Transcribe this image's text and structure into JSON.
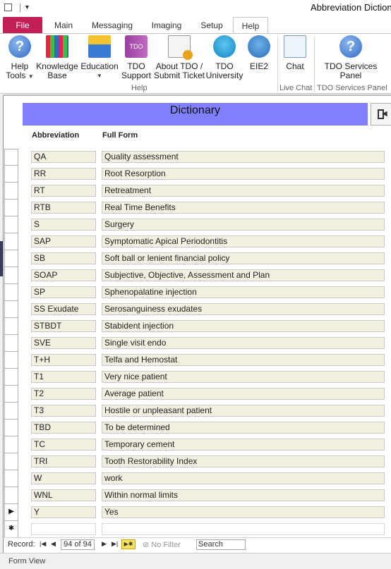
{
  "window": {
    "title": "Abbreviation Dictionary"
  },
  "ribbon": {
    "tabs": [
      {
        "label": "File"
      },
      {
        "label": "Main"
      },
      {
        "label": "Messaging"
      },
      {
        "label": "Imaging"
      },
      {
        "label": "Setup"
      },
      {
        "label": "Help"
      }
    ],
    "buttons": [
      {
        "line1": "Help",
        "line2": "Tools",
        "icon": "help-tools-icon"
      },
      {
        "line1": "Knowledge",
        "line2": "Base",
        "icon": "knowledge-base-icon"
      },
      {
        "line1": "Education",
        "line2": "",
        "icon": "education-icon"
      },
      {
        "line1": "TDO",
        "line2": "Support",
        "icon": "tdo-support-icon"
      },
      {
        "line1": "About TDO /",
        "line2": "Submit Ticket",
        "icon": "about-tdo-icon"
      },
      {
        "line1": "TDO",
        "line2": "University",
        "icon": "tdo-university-icon"
      },
      {
        "line1": "EIE2",
        "line2": "",
        "icon": "eie2-icon"
      },
      {
        "line1": "Chat",
        "line2": "",
        "icon": "chat-icon"
      },
      {
        "line1": "TDO Services",
        "line2": "Panel",
        "icon": "tdo-services-panel-icon"
      }
    ],
    "groups": [
      {
        "label": "Help"
      },
      {
        "label": "Live Chat"
      },
      {
        "label": "TDO Services Panel"
      }
    ]
  },
  "form": {
    "header": "Dictionary",
    "columns": {
      "abbreviation": "Abbreviation",
      "full_form": "Full Form"
    },
    "rows": [
      {
        "abbr": "QA",
        "full": "Quality assessment"
      },
      {
        "abbr": "RR",
        "full": "Root Resorption"
      },
      {
        "abbr": "RT",
        "full": "Retreatment"
      },
      {
        "abbr": "RTB",
        "full": "Real Time Benefits"
      },
      {
        "abbr": "S",
        "full": "Surgery"
      },
      {
        "abbr": "SAP",
        "full": "Symptomatic Apical Periodontitis"
      },
      {
        "abbr": "SB",
        "full": "Soft ball or lenient financial policy"
      },
      {
        "abbr": "SOAP",
        "full": "Subjective, Objective, Assessment and Plan"
      },
      {
        "abbr": "SP",
        "full": "Sphenopalatine injection"
      },
      {
        "abbr": "SS Exudate",
        "full": "Serosanguiness exudates"
      },
      {
        "abbr": "STBDT",
        "full": "Stabident injection"
      },
      {
        "abbr": "SVE",
        "full": "Single visit endo"
      },
      {
        "abbr": "T+H",
        "full": "Telfa and Hemostat"
      },
      {
        "abbr": "T1",
        "full": "Very nice patient"
      },
      {
        "abbr": "T2",
        "full": "Average patient"
      },
      {
        "abbr": "T3",
        "full": "Hostile or unpleasant patient"
      },
      {
        "abbr": "TBD",
        "full": "To be determined"
      },
      {
        "abbr": "TC",
        "full": "Temporary cement"
      },
      {
        "abbr": "TRI",
        "full": "Tooth Restorability Index"
      },
      {
        "abbr": "W",
        "full": "work"
      },
      {
        "abbr": "WNL",
        "full": "Within normal limits"
      },
      {
        "abbr": "Y",
        "full": "Yes"
      },
      {
        "abbr": "",
        "full": ""
      }
    ],
    "current_marker": "▶",
    "new_marker": "✱"
  },
  "navigator": {
    "label": "Record:",
    "position": "94 of 94",
    "filter": "No Filter",
    "search": "Search"
  },
  "status": {
    "view": "Form View"
  }
}
